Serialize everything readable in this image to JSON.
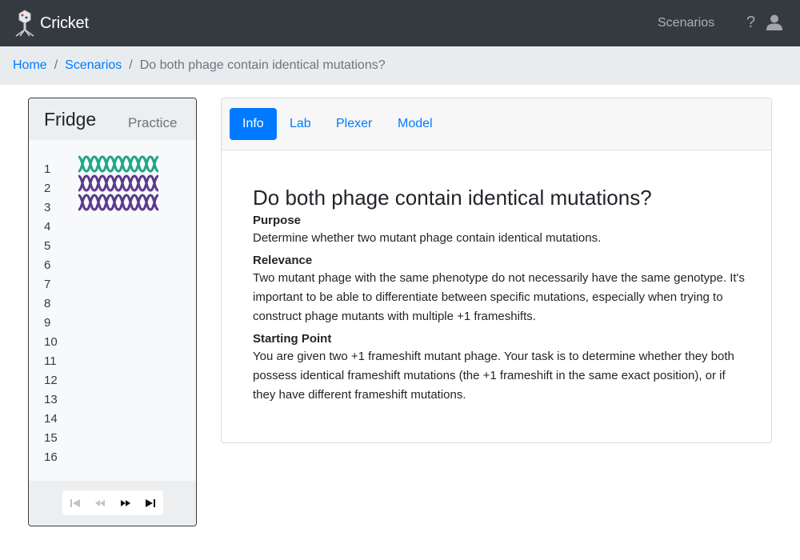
{
  "navbar": {
    "brand": "Cricket",
    "scenarios_link": "Scenarios",
    "help_icon": "?"
  },
  "breadcrumb": {
    "home": "Home",
    "scenarios": "Scenarios",
    "current": "Do both phage contain identical mutations?"
  },
  "fridge": {
    "title": "Fridge",
    "practice_label": "Practice",
    "slots": [
      "1",
      "2",
      "3",
      "4",
      "5",
      "6",
      "7",
      "8",
      "9",
      "10",
      "11",
      "12",
      "13",
      "14",
      "15",
      "16"
    ],
    "phage_colors": [
      "#1fa787",
      "#5b3a8c",
      "#5b3a8c"
    ]
  },
  "tabs": {
    "info": "Info",
    "lab": "Lab",
    "plexer": "Plexer",
    "model": "Model"
  },
  "info": {
    "heading": "Do both phage contain identical mutations?",
    "purpose_title": "Purpose",
    "purpose_text": "Determine whether two mutant phage contain identical mutations.",
    "relevance_title": "Relevance",
    "relevance_text": "Two mutant phage with the same phenotype do not necessarily have the same genotype. It's important to be able to differentiate between specific mutations, especially when trying to construct phage mutants with multiple +1 frameshifts.",
    "start_title": "Starting Point",
    "start_text": "You are given two +1 frameshift mutant phage. Your task is to determine whether they both possess identical frameshift mutations (the +1 frameshift in the same exact position), or if they have different frameshift mutations."
  },
  "colors": {
    "accent": "#007bff",
    "navbar": "#343a40"
  }
}
